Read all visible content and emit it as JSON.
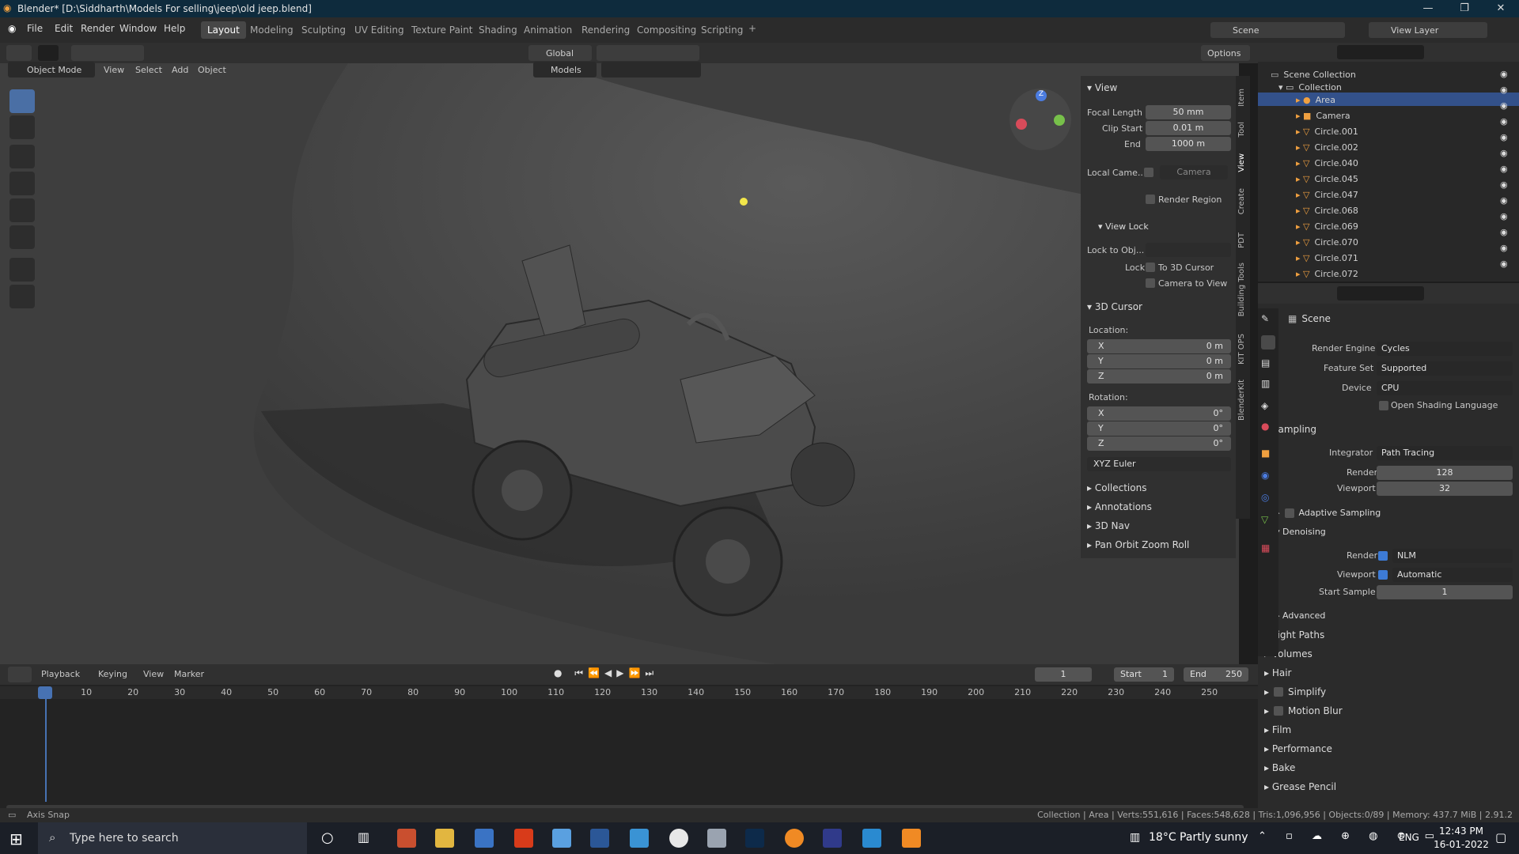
{
  "title": "Blender* [D:\\Siddharth\\Models For selling\\jeep\\old jeep.blend]",
  "menu": [
    "File",
    "Edit",
    "Render",
    "Window",
    "Help"
  ],
  "workspaces": [
    "Layout",
    "Modeling",
    "Sculpting",
    "UV Editing",
    "Texture Paint",
    "Shading",
    "Animation",
    "Rendering",
    "Compositing",
    "Scripting"
  ],
  "scene_label": "Scene",
  "view_layer_label": "View Layer",
  "viewport": {
    "mode": "Object Mode",
    "menus": [
      "View",
      "Select",
      "Add",
      "Object"
    ],
    "orientation": "Global",
    "options": "Options",
    "models": "Models"
  },
  "npanel": {
    "view_title": "View",
    "focal_label": "Focal Length",
    "focal": "50 mm",
    "clip_start_label": "Clip Start",
    "clip_start": "0.01 m",
    "end_label": "End",
    "end": "1000 m",
    "local_cam_label": "Local Came...",
    "local_cam": "Camera",
    "render_region": "Render Region",
    "view_lock": "View Lock",
    "lock_obj": "Lock to Obj...",
    "lock": "Lock",
    "to_cursor": "To 3D Cursor",
    "cam_to_view": "Camera to View",
    "cursor_title": "3D Cursor",
    "location": "Location:",
    "rotation": "Rotation:",
    "x": "X",
    "y": "Y",
    "z": "Z",
    "loc_val": "0 m",
    "rot_val": "0°",
    "rot_mode": "XYZ Euler",
    "collapsed": [
      "Collections",
      "Annotations",
      "3D Nav",
      "Pan Orbit Zoom Roll"
    ]
  },
  "vtabs": [
    "Item",
    "Tool",
    "View",
    "Create",
    "PDT",
    "Building Tools",
    "KIT OPS",
    "BlenderKit"
  ],
  "outliner": {
    "scene_collection": "Scene Collection",
    "collection": "Collection",
    "items": [
      "Area",
      "Camera",
      "Circle.001",
      "Circle.002",
      "Circle.040",
      "Circle.045",
      "Circle.047",
      "Circle.068",
      "Circle.069",
      "Circle.070",
      "Circle.071",
      "Circle.072"
    ]
  },
  "props": {
    "scene": "Scene",
    "render_engine_label": "Render Engine",
    "render_engine": "Cycles",
    "feature_set_label": "Feature Set",
    "feature_set": "Supported",
    "device_label": "Device",
    "device": "CPU",
    "osl": "Open Shading Language",
    "sampling": "Sampling",
    "integrator_label": "Integrator",
    "integrator": "Path Tracing",
    "render_label": "Render",
    "render": "128",
    "viewport_label": "Viewport",
    "viewport": "32",
    "adaptive": "Adaptive Sampling",
    "denoising": "Denoising",
    "den_render": "NLM",
    "den_viewport": "Automatic",
    "start_sample_label": "Start Sample",
    "start_sample": "1",
    "advanced": "Advanced",
    "sections": [
      "Light Paths",
      "Volumes",
      "Hair",
      "Simplify",
      "Motion Blur",
      "Film",
      "Performance",
      "Bake",
      "Grease Pencil"
    ]
  },
  "timeline": {
    "menus": [
      "Playback",
      "Keying",
      "View",
      "Marker"
    ],
    "current": "1",
    "start_label": "Start",
    "start": "1",
    "end_label": "End",
    "end": "250",
    "ticks": [
      "1",
      "10",
      "20",
      "30",
      "40",
      "50",
      "60",
      "70",
      "80",
      "90",
      "100",
      "110",
      "120",
      "130",
      "140",
      "150",
      "160",
      "170",
      "180",
      "190",
      "200",
      "210",
      "220",
      "230",
      "240",
      "250"
    ]
  },
  "status": {
    "left": "Axis Snap",
    "right": "Collection | Area | Verts:551,616 | Faces:548,628 | Tris:1,096,956 | Objects:0/89 | Memory: 437.7 MiB | 2.91.2"
  },
  "taskbar": {
    "search": "Type here to search",
    "weather": "18°C  Partly sunny",
    "lang": "ENG",
    "time": "12:43 PM",
    "date": "16-01-2022"
  }
}
